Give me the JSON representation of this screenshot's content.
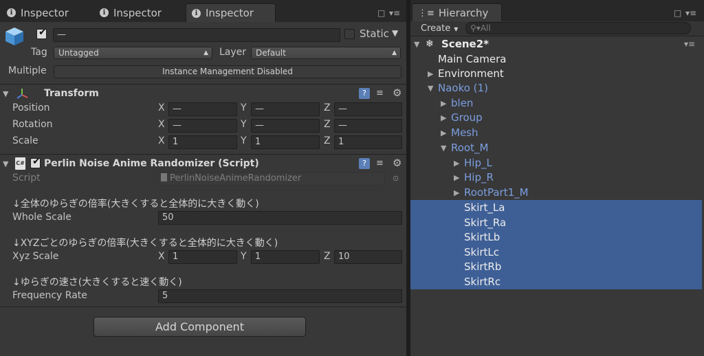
{
  "inspector_tabs": [
    {
      "label": "Inspector"
    },
    {
      "label": "Inspector"
    },
    {
      "label": "Inspector"
    }
  ],
  "object": {
    "name_value": "—",
    "static_label": "Static",
    "tag_label": "Tag",
    "tag_value": "Untagged",
    "layer_label": "Layer",
    "layer_value": "Default",
    "multiple_label": "Multiple",
    "instance_management": "Instance Management Disabled"
  },
  "transform": {
    "title": "Transform",
    "rows": [
      {
        "label": "Position",
        "x": "—",
        "y": "—",
        "z": "—"
      },
      {
        "label": "Rotation",
        "x": "—",
        "y": "—",
        "z": "—"
      },
      {
        "label": "Scale",
        "x": "1",
        "y": "1",
        "z": "1"
      }
    ],
    "axis": {
      "x": "X",
      "y": "Y",
      "z": "Z"
    }
  },
  "script_component": {
    "title": "Perlin Noise Anime Randomizer (Script)",
    "script_label": "Script",
    "script_value": "PerlinNoiseAnimeRandomizer",
    "note1": "↓全体のゆらぎの倍率(大きくすると全体的に大きく動く)",
    "whole_scale_label": "Whole Scale",
    "whole_scale_value": "50",
    "note2": "↓XYZごとのゆらぎの倍率(大きくすると全体的に大きく動く)",
    "xyz_scale_label": "Xyz Scale",
    "xyz": {
      "x": "1",
      "y": "1",
      "z": "10"
    },
    "note3": "↓ゆらぎの速さ(大きくすると速く動く)",
    "frequency_label": "Frequency Rate",
    "frequency_value": "5"
  },
  "add_component_label": "Add Component",
  "hierarchy": {
    "tab_label": "Hierarchy",
    "create_label": "Create",
    "search_placeholder": "All",
    "scene_name": "Scene2*",
    "items": [
      {
        "label": "Main Camera"
      },
      {
        "label": "Environment"
      },
      {
        "label": "Naoko (1)"
      },
      {
        "label": "blen"
      },
      {
        "label": "Group"
      },
      {
        "label": "Mesh"
      },
      {
        "label": "Root_M"
      },
      {
        "label": "Hip_L"
      },
      {
        "label": "Hip_R"
      },
      {
        "label": "RootPart1_M"
      },
      {
        "label": "Skirt_La"
      },
      {
        "label": "Skirt_Ra"
      },
      {
        "label": "SkirtLb"
      },
      {
        "label": "SkirtLc"
      },
      {
        "label": "SkirtRb"
      },
      {
        "label": "SkirtRc"
      }
    ]
  },
  "colors": {
    "background": "#383838",
    "selection": "#3e5f96",
    "prefab_blue": "#7b9ee0"
  }
}
